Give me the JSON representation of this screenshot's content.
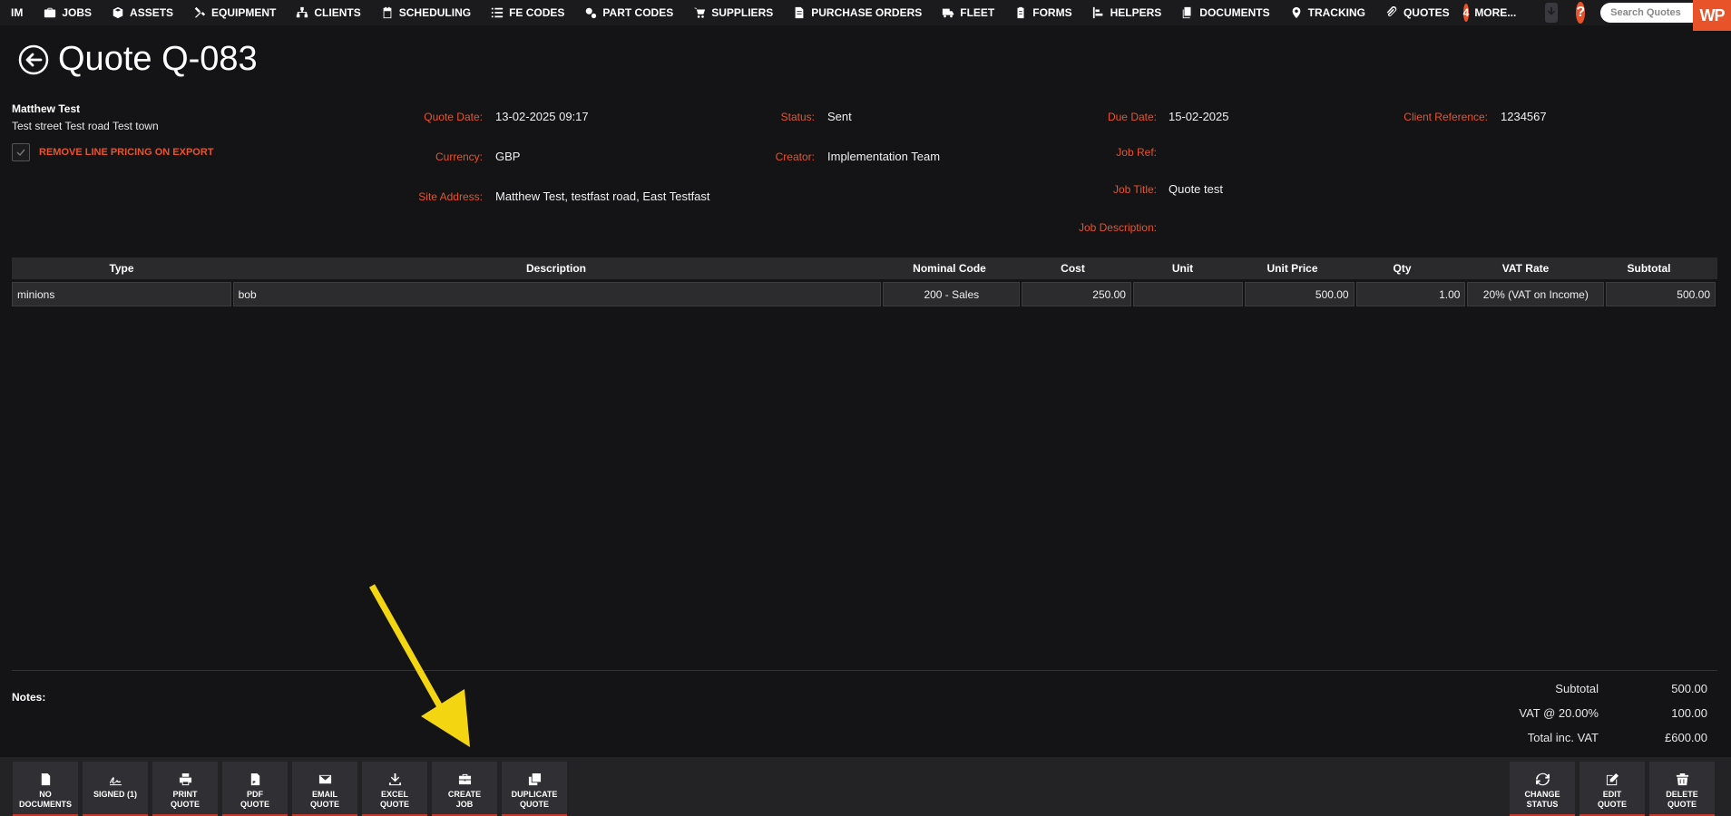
{
  "nav": {
    "brand": "IM",
    "items": [
      {
        "label": "JOBS",
        "icon": "briefcase-icon"
      },
      {
        "label": "ASSETS",
        "icon": "cube-icon"
      },
      {
        "label": "EQUIPMENT",
        "icon": "tools-icon"
      },
      {
        "label": "CLIENTS",
        "icon": "sitemap-icon"
      },
      {
        "label": "SCHEDULING",
        "icon": "calendar-icon"
      },
      {
        "label": "FE CODES",
        "icon": "list-icon"
      },
      {
        "label": "PART CODES",
        "icon": "cogs-icon"
      },
      {
        "label": "SUPPLIERS",
        "icon": "cart-icon"
      },
      {
        "label": "PURCHASE ORDERS",
        "icon": "file-invoice-icon"
      },
      {
        "label": "FLEET",
        "icon": "truck-icon"
      },
      {
        "label": "FORMS",
        "icon": "clipboard-icon"
      },
      {
        "label": "HELPERS",
        "icon": "user-plus-icon"
      },
      {
        "label": "DOCUMENTS",
        "icon": "copy-icon"
      },
      {
        "label": "TRACKING",
        "icon": "map-marker-icon"
      },
      {
        "label": "QUOTES",
        "icon": "paperclip-icon"
      }
    ],
    "more_count": "4",
    "more_label": "MORE...",
    "help_label": "?",
    "search_placeholder": "Search Quotes",
    "logo_text": "WP"
  },
  "page": {
    "title": "Quote Q-083"
  },
  "client": {
    "name": "Matthew Test",
    "address": "Test street Test road Test town",
    "remove_pricing_label": "REMOVE LINE PRICING ON EXPORT"
  },
  "fields": {
    "quote_date_label": "Quote Date:",
    "quote_date": "13-02-2025 09:17",
    "currency_label": "Currency:",
    "currency": "GBP",
    "site_address_label": "Site Address:",
    "site_address": "Matthew Test, testfast road, East Testfast",
    "status_label": "Status:",
    "status": "Sent",
    "creator_label": "Creator:",
    "creator": "Implementation Team",
    "due_date_label": "Due Date:",
    "due_date": "15-02-2025",
    "job_ref_label": "Job Ref:",
    "job_ref": "",
    "job_title_label": "Job Title:",
    "job_title": "Quote test",
    "job_desc_label": "Job Description:",
    "job_desc": "",
    "client_ref_label": "Client Reference:",
    "client_ref": "1234567"
  },
  "table": {
    "headers": [
      "Type",
      "Description",
      "Nominal Code",
      "Cost",
      "Unit",
      "Unit Price",
      "Qty",
      "VAT Rate",
      "Subtotal"
    ],
    "rows": [
      [
        "minions",
        "bob",
        "200 - Sales",
        "250.00",
        "",
        "500.00",
        "1.00",
        "20% (VAT on Income)",
        "500.00"
      ]
    ]
  },
  "notes_label": "Notes:",
  "totals": {
    "subtotal_label": "Subtotal",
    "subtotal": "500.00",
    "vat_label": "VAT @ 20.00%",
    "vat": "100.00",
    "total_label": "Total inc. VAT",
    "total": "£600.00"
  },
  "actions": {
    "no_documents": "NO\nDOCUMENTS",
    "signed": "SIGNED (1)",
    "print": "PRINT\nQUOTE",
    "pdf": "PDF\nQUOTE",
    "email": "EMAIL\nQUOTE",
    "excel": "EXCEL\nQUOTE",
    "create_job": "CREATE\nJOB",
    "duplicate": "DUPLICATE\nQUOTE",
    "change_status": "CHANGE\nSTATUS",
    "edit": "EDIT\nQUOTE",
    "delete": "DELETE\nQUOTE"
  },
  "colors": {
    "accent": "#e8532a",
    "background": "#141416",
    "annotation_arrow": "#f3d512"
  }
}
